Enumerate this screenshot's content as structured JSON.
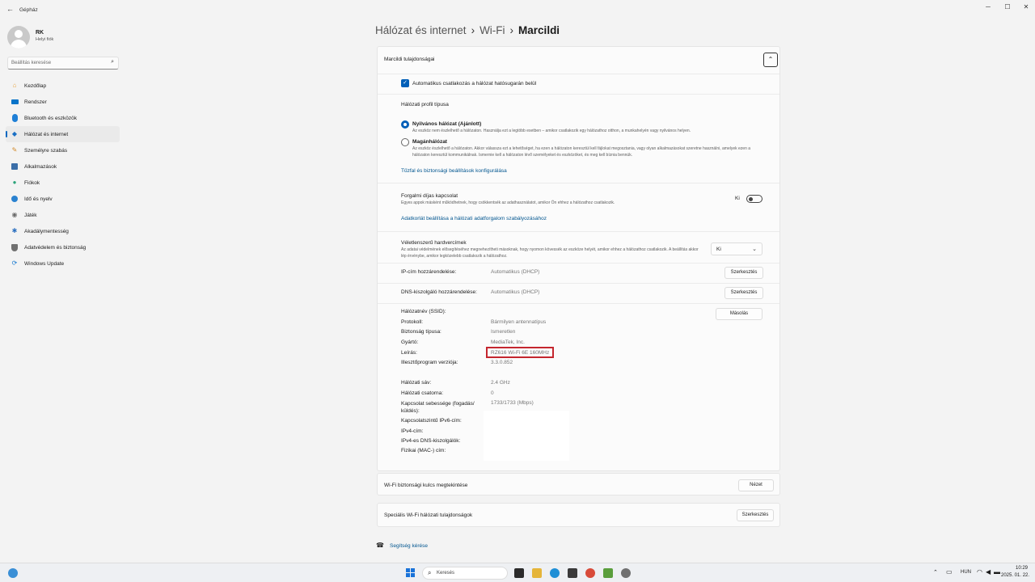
{
  "window": {
    "title": "Gépház",
    "back_icon": "back-arrow-icon",
    "min": "─",
    "max": "☐",
    "close": "✕"
  },
  "user": {
    "name": "RK",
    "subtitle": "Helyi fiók"
  },
  "search": {
    "placeholder": "Beállítás keresése"
  },
  "nav": {
    "items": [
      {
        "label": "Kezdőlap",
        "icon": "home-icon",
        "color": "#e8a33d"
      },
      {
        "label": "Rendszer",
        "icon": "system-icon",
        "color": "#0a74c9"
      },
      {
        "label": "Bluetooth és eszközök",
        "icon": "bluetooth-icon",
        "color": "#1e7fd6"
      },
      {
        "label": "Hálózat és internet",
        "icon": "wifi-icon",
        "color": "#1a6fc4"
      },
      {
        "label": "Személyre szabás",
        "icon": "brush-icon",
        "color": "#d28a2a"
      },
      {
        "label": "Alkalmazások",
        "icon": "apps-icon",
        "color": "#3b6ea8"
      },
      {
        "label": "Fiókok",
        "icon": "account-icon",
        "color": "#2ba37a"
      },
      {
        "label": "Idő és nyelv",
        "icon": "globe-icon",
        "color": "#2a82d0"
      },
      {
        "label": "Játék",
        "icon": "gamepad-icon",
        "color": "#6b6b6b"
      },
      {
        "label": "Akadálymentesség",
        "icon": "accessibility-icon",
        "color": "#2a6fbf"
      },
      {
        "label": "Adatvédelem és biztonság",
        "icon": "shield-icon",
        "color": "#707070"
      },
      {
        "label": "Windows Update",
        "icon": "update-icon",
        "color": "#1b7bd0"
      }
    ],
    "selected_index": 3
  },
  "breadcrumb": {
    "p1": "Hálózat és internet",
    "p2": "Wi-Fi",
    "p3": "Marcildi"
  },
  "props": {
    "header": "Marcildi tulajdonságai",
    "auto_connect": "Automatikus csatlakozás a hálózat hatósugarán belül",
    "profile_title": "Hálózati profil típusa",
    "public_label": "Nyilvános hálózat (Ajánlott)",
    "public_desc": "Az eszköz nem észlelhető a hálózaton. Használja ezt a legtöbb esetben – amikor csatlakozik egy hálózathoz otthon, a munkahelyén vagy nyilvános helyen.",
    "private_label": "Magánhálózat",
    "private_desc": "Az eszköz észlelhető a hálózaton. Akkor válassza ezt a lehetőséget, ha ezen a hálózaton keresztül kell fájlokat megosztania, vagy olyan alkalmazásokat szeretne használni, amelyek ezen a hálózaton keresztül kommunikálnak. Ismernie kell a hálózaton lévő személyeket és eszközöket, és meg kell bíznia bennük.",
    "firewall_link": "Tűzfal és biztonsági beállítások konfigurálása",
    "metered_title": "Forgalmi díjas kapcsolat",
    "metered_desc": "Egyes appok másként működhetnek, hogy csökkentsék az adathasználatot, amikor Ön ehhez a hálózathoz csatlakozik.",
    "metered_state": "Ki",
    "data_limit_link": "Adatkorlát beállítása a hálózati adatforgalom szabályozásához",
    "random_mac_title": "Véletlenszerű hardvercímek",
    "random_mac_desc": "Az adatai védelmének elősegítéséhez megnehezítheti másoknak, hogy nyomon kövessék az eszköze helyét, amikor ehhez a hálózathoz csatlakozik. A beállítás akkor lép érvénybe, amikor legközelebb csatlakozik a hálózathoz.",
    "random_mac_value": "Ki",
    "ip_label": "IP-cím hozzárendelése:",
    "ip_value": "Automatikus (DHCP)",
    "dns_label": "DNS-kiszolgáló hozzárendelése:",
    "dns_value": "Automatikus (DHCP)",
    "edit_label": "Szerkesztés",
    "copy_label": "Másolás",
    "details": [
      {
        "label": "Hálózatnév (SSID):",
        "value": ""
      },
      {
        "label": "Protokoll:",
        "value": "Bármilyen antennatípus"
      },
      {
        "label": "Biztonság típusa:",
        "value": "Ismeretlen"
      },
      {
        "label": "Gyártó:",
        "value": "MediaTek, Inc."
      },
      {
        "label": "Leírás:",
        "value": "RZ616 Wi-Fi 6E 160MHz"
      },
      {
        "label": "Illesztőprogram verziója:",
        "value": "3.3.0.852"
      }
    ],
    "details2": [
      {
        "label": "Hálózati sáv:",
        "value": "2.4 GHz"
      },
      {
        "label": "Hálózati csatorna:",
        "value": "0"
      },
      {
        "label": "Kapcsolat sebessége (fogadás/ küldés):",
        "value": "1733/1733 (Mbps)"
      },
      {
        "label": "Kapcsolatszintű IPv6-cím:",
        "value": ""
      },
      {
        "label": "IPv4-cím:",
        "value": ""
      },
      {
        "label": "IPv4-es DNS-kiszolgálók:",
        "value": ""
      },
      {
        "label": "Fizikai (MAC-) cím:",
        "value": ""
      }
    ]
  },
  "wifi_key": {
    "label": "Wi-Fi biztonsági kulcs megtekintése",
    "button": "Nézet"
  },
  "advanced": {
    "label": "Speciális Wi-Fi hálózati tulajdonságok",
    "button": "Szerkesztés"
  },
  "help": {
    "label": "Segítség kérése"
  },
  "taskbar": {
    "search_placeholder": "Keresés",
    "lang": "HUN",
    "time": "10:29",
    "date": "2025. 01. 22."
  },
  "colors": {
    "accent": "#005fb8",
    "highlight_box": "#c4262e"
  }
}
